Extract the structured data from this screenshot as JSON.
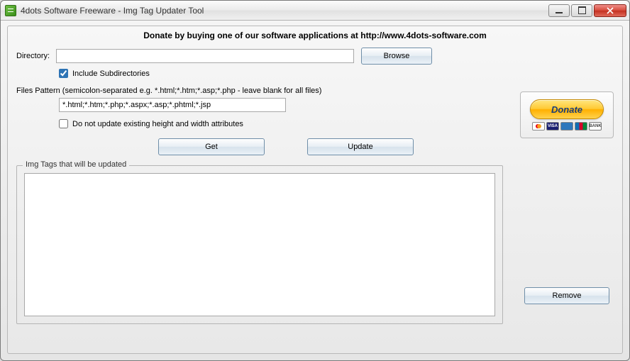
{
  "window": {
    "title": "4dots Software Freeware - Img Tag Updater Tool"
  },
  "header": {
    "donate_text": "Donate by buying one of our software applications at http://www.4dots-software.com"
  },
  "directory": {
    "label": "Directory:",
    "value": "",
    "browse": "Browse"
  },
  "include_subdirs": {
    "label": "Include Subdirectories",
    "checked": true
  },
  "files_pattern": {
    "label": "Files Pattern (semicolon-separated e.g. *.html;*.htm;*.asp;*.php - leave blank for all files)",
    "value": "*.html;*.htm;*.php;*.aspx;*.asp;*.phtml;*.jsp"
  },
  "dont_update": {
    "label": "Do not update existing height and width attributes",
    "checked": false
  },
  "actions": {
    "get": "Get",
    "update": "Update",
    "remove": "Remove"
  },
  "list": {
    "legend": "Img Tags that will be updated"
  },
  "donate": {
    "button": "Donate",
    "cards": {
      "visa": "VISA",
      "bank": "BANK"
    }
  }
}
